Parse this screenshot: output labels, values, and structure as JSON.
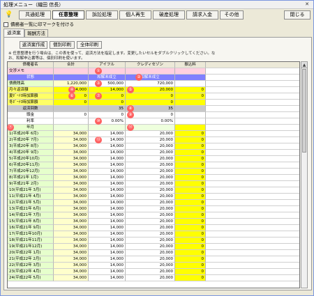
{
  "window": {
    "title": "処理メニュー（織田 信長）",
    "close_glyph": "✕"
  },
  "toolbar": {
    "icon": "lightbulb-icon",
    "buttons": [
      {
        "label": "共通処理"
      },
      {
        "label": "任意整理"
      },
      {
        "label": "訴訟処理"
      },
      {
        "label": "個人再生"
      },
      {
        "label": "破産処理"
      },
      {
        "label": "請求入金"
      },
      {
        "label": "その他"
      }
    ],
    "close_label": "閉じる"
  },
  "check": {
    "label": "債務者一覧に印マークを付ける"
  },
  "tabs": [
    {
      "label": "返済案"
    },
    {
      "label": "報酬方法"
    }
  ],
  "panel": {
    "buttons": [
      {
        "label": "返済案作成"
      },
      {
        "label": "個別印刷"
      },
      {
        "label": "全体印刷"
      }
    ],
    "note": "※ 任意整理を行う場合は、この表を使って、返済方法を指定します。変更したいセルをダブルクリックしてください。なお、和解申込書等は、個別印刷を使います。"
  },
  "grid": {
    "headers": [
      "債権者名",
      "合計",
      "アイフル",
      "クレディセゾン",
      "振込料"
    ],
    "memo_label": "交渉メモ",
    "status_label": "状態",
    "status_values": [
      "和解未成立",
      "和解未成立"
    ],
    "debt_label": "債務残高",
    "debt_values": [
      "1,220,000",
      "500,000",
      "720,000"
    ],
    "monthly_label": "月々返済額",
    "monthly_values": [
      "34,000",
      "14,000",
      "20,000",
      "0"
    ],
    "bonus_label": "夏ﾎﾞｰﾅｽ時加算額",
    "bonus_values": [
      "0",
      "0",
      "0",
      "0"
    ],
    "winter_label": "冬ﾎﾞｰﾅｽ時加算額",
    "winter_values": [
      "0",
      "0",
      "0"
    ],
    "count_label": "返済回数",
    "count_values": [
      "35",
      "35"
    ],
    "lump_label": "頭金",
    "lump_values": [
      "0",
      "0",
      "0"
    ],
    "rate_label": "利率",
    "rate_values": [
      "0.00%",
      "0.00%"
    ],
    "ym_label": "年月",
    "schedule": [
      {
        "label": "1(平成20年 6月)",
        "total": "34,000",
        "a": "14,000",
        "b": "20,000",
        "fee": "0"
      },
      {
        "label": "2(平成20年 7月)",
        "total": "34,000",
        "a": "14,000",
        "b": "20,000",
        "fee": "0"
      },
      {
        "label": "3(平成20年 8月)",
        "total": "34,000",
        "a": "14,000",
        "b": "20,000",
        "fee": "0"
      },
      {
        "label": "4(平成20年 9月)",
        "total": "34,000",
        "a": "14,000",
        "b": "20,000",
        "fee": "0"
      },
      {
        "label": "5(平成20年10月)",
        "total": "34,000",
        "a": "14,000",
        "b": "20,000",
        "fee": "0"
      },
      {
        "label": "6(平成20年11月)",
        "total": "34,000",
        "a": "14,000",
        "b": "20,000",
        "fee": "0"
      },
      {
        "label": "7(平成20年12月)",
        "total": "34,000",
        "a": "14,000",
        "b": "20,000",
        "fee": "0"
      },
      {
        "label": "8(平成21年 1月)",
        "total": "34,000",
        "a": "14,000",
        "b": "20,000",
        "fee": "0"
      },
      {
        "label": "9(平成21年 2月)",
        "total": "34,000",
        "a": "14,000",
        "b": "20,000",
        "fee": "0"
      },
      {
        "label": "10(平成21年 3月)",
        "total": "34,000",
        "a": "14,000",
        "b": "20,000",
        "fee": "0"
      },
      {
        "label": "11(平成21年 4月)",
        "total": "34,000",
        "a": "14,000",
        "b": "20,000",
        "fee": "0"
      },
      {
        "label": "12(平成21年 5月)",
        "total": "34,000",
        "a": "14,000",
        "b": "20,000",
        "fee": "0"
      },
      {
        "label": "13(平成21年 6月)",
        "total": "34,000",
        "a": "14,000",
        "b": "20,000",
        "fee": "0"
      },
      {
        "label": "14(平成21年 7月)",
        "total": "34,000",
        "a": "14,000",
        "b": "20,000",
        "fee": "0"
      },
      {
        "label": "15(平成21年 8月)",
        "total": "34,000",
        "a": "14,000",
        "b": "20,000",
        "fee": "0"
      },
      {
        "label": "16(平成21年 9月)",
        "total": "34,000",
        "a": "14,000",
        "b": "20,000",
        "fee": "0"
      },
      {
        "label": "17(平成21年10月)",
        "total": "34,000",
        "a": "14,000",
        "b": "20,000",
        "fee": "0"
      },
      {
        "label": "18(平成21年11月)",
        "total": "34,000",
        "a": "14,000",
        "b": "20,000",
        "fee": "0"
      },
      {
        "label": "19(平成21年12月)",
        "total": "34,000",
        "a": "14,000",
        "b": "20,000",
        "fee": "0"
      },
      {
        "label": "20(平成22年 1月)",
        "total": "34,000",
        "a": "14,000",
        "b": "20,000",
        "fee": "0"
      },
      {
        "label": "21(平成22年 2月)",
        "total": "34,000",
        "a": "14,000",
        "b": "20,000",
        "fee": "0"
      },
      {
        "label": "22(平成22年 3月)",
        "total": "34,000",
        "a": "14,000",
        "b": "20,000",
        "fee": "0"
      },
      {
        "label": "23(平成22年 4月)",
        "total": "34,000",
        "a": "14,000",
        "b": "20,000",
        "fee": "0"
      },
      {
        "label": "24(平成22年 5月)",
        "total": "34,000",
        "a": "14,000",
        "b": "20,000",
        "fee": "0"
      }
    ]
  },
  "markers": [
    "①",
    "②",
    "③",
    "④",
    "⑤",
    "⑥",
    "⑦",
    "⑧",
    "⑨",
    "⑩",
    "⑪",
    "⑫",
    "⑬"
  ],
  "scroll": {
    "up": "▲"
  }
}
